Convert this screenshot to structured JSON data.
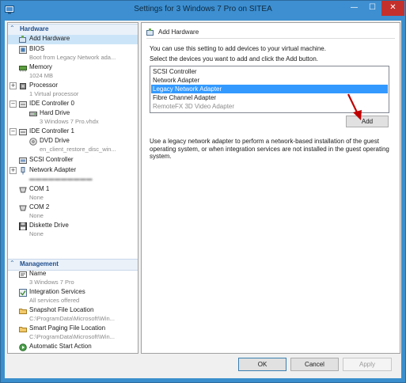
{
  "window": {
    "title": "Settings for 3 Windows 7 Pro on SITEA"
  },
  "titlebar": {
    "min_glyph": "—",
    "max_glyph": "☐",
    "close_glyph": "✕"
  },
  "sidebar": {
    "hardware_header": "Hardware",
    "management_header": "Management",
    "hardware_items": [
      {
        "name": "Add Hardware",
        "sub": ""
      },
      {
        "name": "BIOS",
        "sub": "Boot from Legacy Network ada..."
      },
      {
        "name": "Memory",
        "sub": "1024 MB"
      },
      {
        "name": "Processor",
        "sub": "1 Virtual processor"
      },
      {
        "name": "IDE Controller 0",
        "sub": ""
      },
      {
        "name": "Hard Drive",
        "sub": "3 Windows 7 Pro.vhdx"
      },
      {
        "name": "IDE Controller 1",
        "sub": ""
      },
      {
        "name": "DVD Drive",
        "sub": "en_client_restore_disc_win..."
      },
      {
        "name": "SCSI Controller",
        "sub": ""
      },
      {
        "name": "Network Adapter",
        "sub": ""
      },
      {
        "name": "COM 1",
        "sub": "None"
      },
      {
        "name": "COM 2",
        "sub": "None"
      },
      {
        "name": "Diskette Drive",
        "sub": "None"
      }
    ],
    "management_items": [
      {
        "name": "Name",
        "sub": "3 Windows 7 Pro"
      },
      {
        "name": "Integration Services",
        "sub": "All services offered"
      },
      {
        "name": "Snapshot File Location",
        "sub": "C:\\ProgramData\\Microsoft\\Win..."
      },
      {
        "name": "Smart Paging File Location",
        "sub": "C:\\ProgramData\\Microsoft\\Win..."
      },
      {
        "name": "Automatic Start Action",
        "sub": ""
      }
    ]
  },
  "main": {
    "header": "Add Hardware",
    "intro": "You can use this setting to add devices to your virtual machine.",
    "instruction": "Select the devices you want to add and click the Add button.",
    "devices": [
      {
        "label": "SCSI Controller",
        "state": "normal"
      },
      {
        "label": "Network Adapter",
        "state": "normal"
      },
      {
        "label": "Legacy Network Adapter",
        "state": "selected"
      },
      {
        "label": "Fibre Channel Adapter",
        "state": "normal"
      },
      {
        "label": "RemoteFX 3D Video Adapter",
        "state": "disabled"
      }
    ],
    "add_button": "Add",
    "description_lines": [
      "Use a legacy network adapter to perform a network-based installation of the guest",
      "operating system, or when integration services are not installed in the guest operating",
      "system."
    ]
  },
  "footer": {
    "ok": "OK",
    "cancel": "Cancel",
    "apply": "Apply"
  },
  "colors": {
    "selection": "#3399ff",
    "titlebar": "#3d8fd1",
    "close": "#c4302b",
    "arrow": "#c00000"
  },
  "icons": [
    "app-icon",
    "chevron-up-icon",
    "add-hardware-icon",
    "bios-icon",
    "memory-icon",
    "processor-icon",
    "ide-controller-icon",
    "hard-drive-icon",
    "dvd-drive-icon",
    "scsi-controller-icon",
    "network-adapter-icon",
    "com-port-icon",
    "diskette-drive-icon",
    "name-icon",
    "integration-services-icon",
    "folder-icon",
    "start-action-icon"
  ]
}
